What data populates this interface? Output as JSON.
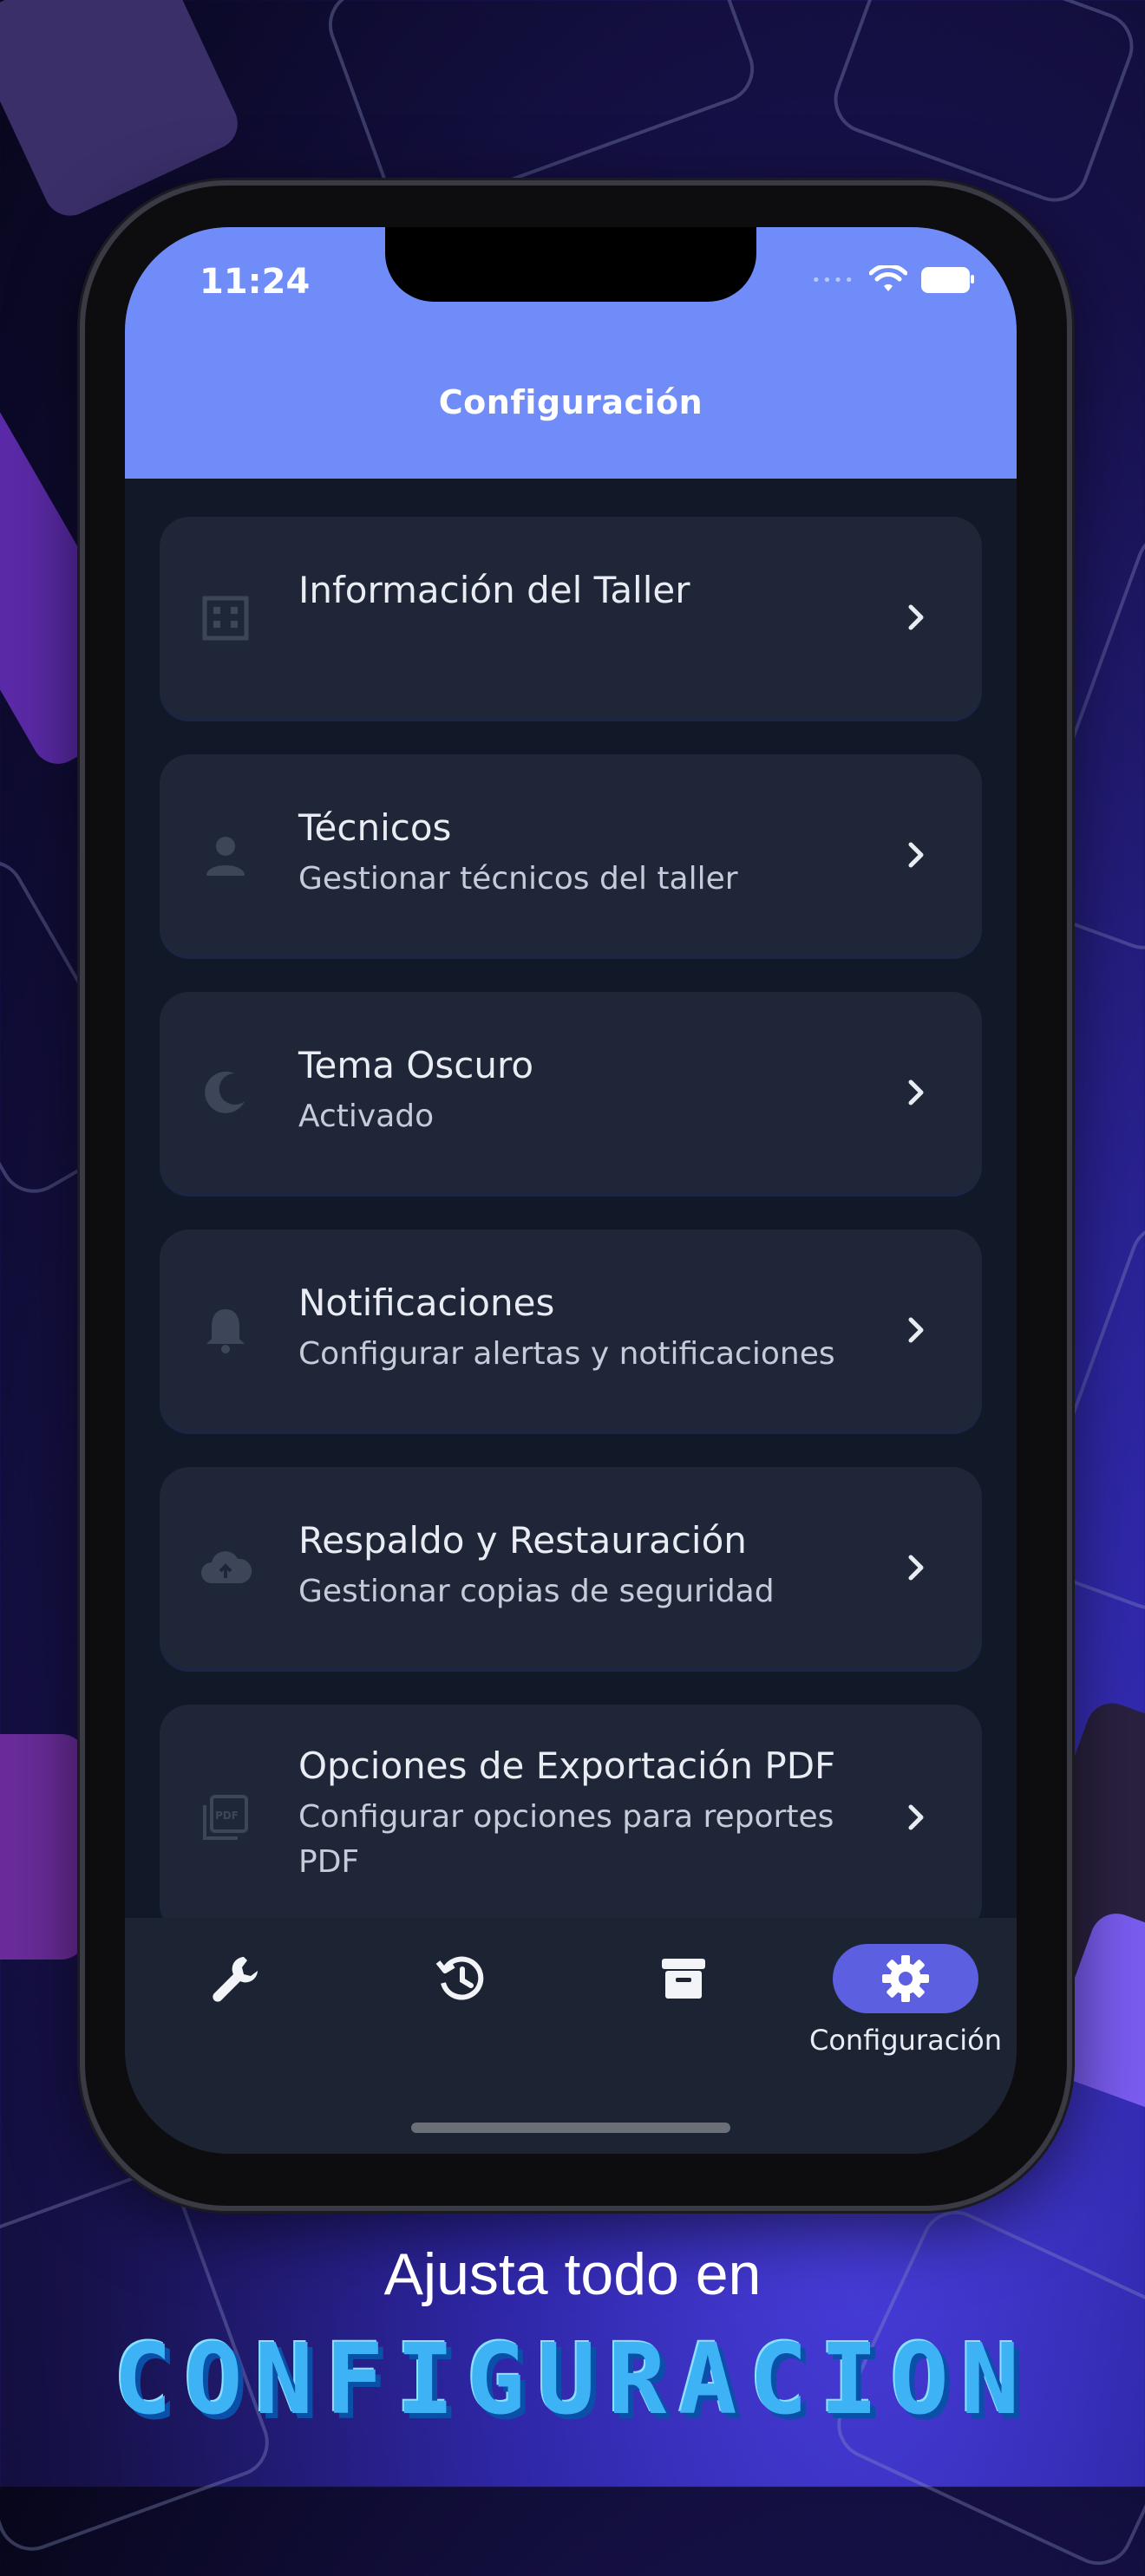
{
  "status_bar": {
    "time": "11:24"
  },
  "app_bar": {
    "title": "Configuración"
  },
  "settings": [
    {
      "icon": "building-icon",
      "label": "Información del Taller",
      "subtitle": ""
    },
    {
      "icon": "person-icon",
      "label": "Técnicos",
      "subtitle": "Gestionar técnicos del taller"
    },
    {
      "icon": "moon-icon",
      "label": "Tema Oscuro",
      "subtitle": "Activado"
    },
    {
      "icon": "bell-icon",
      "label": "Notificaciones",
      "subtitle": "Configurar alertas y notificaciones"
    },
    {
      "icon": "cloud-backup-icon",
      "label": "Respaldo y Restauración",
      "subtitle": "Gestionar copias de seguridad"
    },
    {
      "icon": "pdf-icon",
      "label": "Opciones de Exportación PDF",
      "subtitle": "Configurar opciones para reportes PDF"
    }
  ],
  "bottom_nav": {
    "items": [
      {
        "icon": "wrench-icon",
        "label": ""
      },
      {
        "icon": "history-icon",
        "label": ""
      },
      {
        "icon": "archive-icon",
        "label": ""
      },
      {
        "icon": "gear-icon",
        "label": "Configuración",
        "selected": true
      }
    ]
  },
  "promo": {
    "line1": "Ajusta todo en",
    "line2": "CONFIGURACION"
  },
  "colors": {
    "app_bar": "#6f8cf8",
    "screen_bg": "#111827",
    "card_bg": "#1e2638",
    "nav_selected": "#5b5fe0",
    "headline": "#3db3f5"
  }
}
